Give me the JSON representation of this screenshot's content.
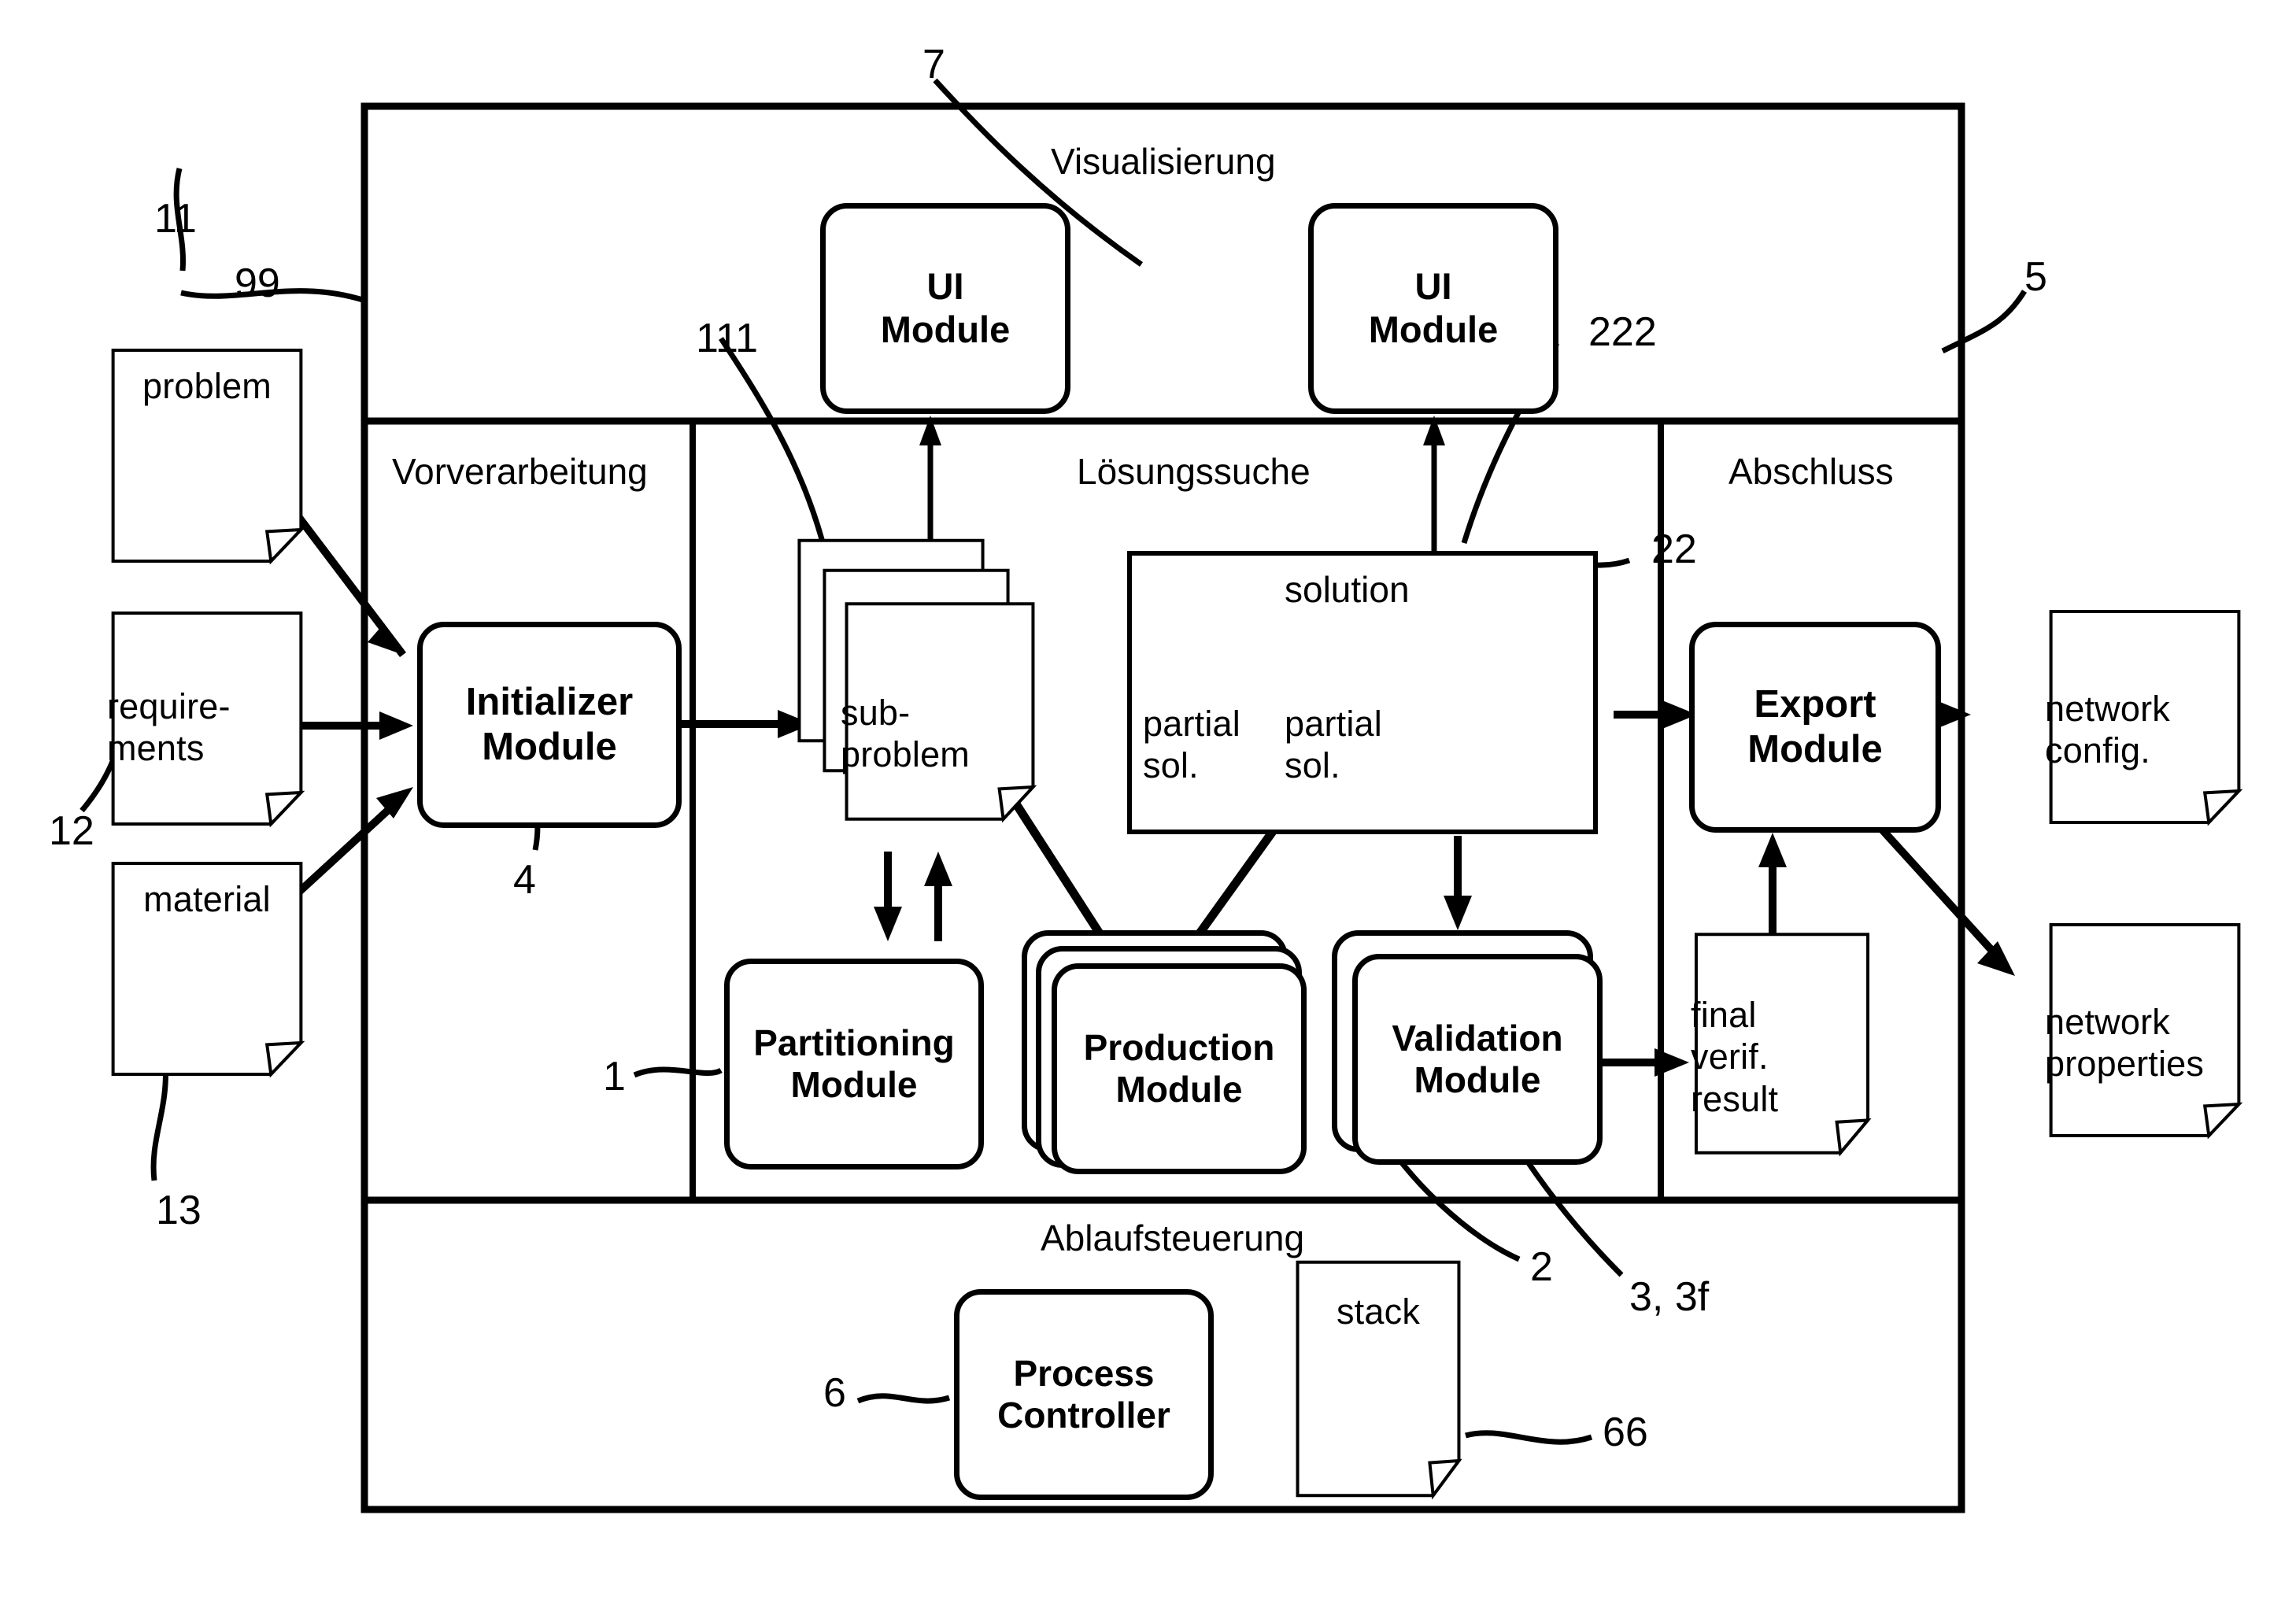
{
  "diagram": {
    "frame_sections": {
      "visualisierung": "Visualisierung",
      "vorverarbeitung": "Vorverarbeitung",
      "loesungssuche": "Lösungssuche",
      "abschluss": "Abschluss",
      "ablaufsteuerung": "Ablaufsteuerung"
    },
    "inputs": [
      {
        "label": "problem",
        "ref": "11"
      },
      {
        "label": "requirements",
        "label_line1": "require-",
        "label_line2": "ments",
        "ref": "12"
      },
      {
        "label": "material",
        "ref": "13"
      }
    ],
    "ui_modules": [
      {
        "line1": "UI",
        "line2": "Module",
        "ref": "7"
      },
      {
        "line1": "UI",
        "line2": "Module",
        "ref": "222"
      }
    ],
    "modules": [
      {
        "line1": "Initializer",
        "line2": "Module",
        "ref": "4"
      },
      {
        "line1": "Partitioning",
        "line2": "Module",
        "ref": "1"
      },
      {
        "line1": "Production",
        "line2": "Module",
        "ref": "2"
      },
      {
        "line1": "Validation",
        "line2": "Module",
        "ref": "3, 3f"
      },
      {
        "line1": "Export",
        "line2": "Module",
        "ref": "5"
      },
      {
        "line1": "Process",
        "line2": "Controller",
        "ref": "6"
      }
    ],
    "subproblem": {
      "line1": "sub-",
      "line2": "problem",
      "ref": "111",
      "stack_count": 3
    },
    "solution": {
      "title": "solution",
      "ref": "22",
      "items": [
        {
          "line1": "partial",
          "line2": "sol."
        },
        {
          "line1": "partial",
          "line2": "sol."
        },
        {
          "line1": "",
          "line2": ""
        }
      ]
    },
    "final_result": {
      "line1": "final",
      "line2": "verif.",
      "line3": "result"
    },
    "stack_doc": {
      "label": "stack",
      "ref": "66"
    },
    "outputs": [
      {
        "line1": "network",
        "line2": "config.",
        "ref": "5"
      },
      {
        "line1": "network",
        "line2": "properties",
        "ref": ""
      }
    ],
    "frame_ref": "99",
    "ref_numbers": {
      "n11": "11",
      "n99": "99",
      "n12": "12",
      "n13": "13",
      "n7": "7",
      "n111": "111",
      "n222": "222",
      "n22": "22",
      "n5": "5",
      "n4": "4",
      "n1": "1",
      "n2": "2",
      "n3_3f": "3, 3f",
      "n6": "6",
      "n66": "66"
    },
    "colors": {
      "ink": "#000000",
      "paper": "#ffffff"
    }
  }
}
